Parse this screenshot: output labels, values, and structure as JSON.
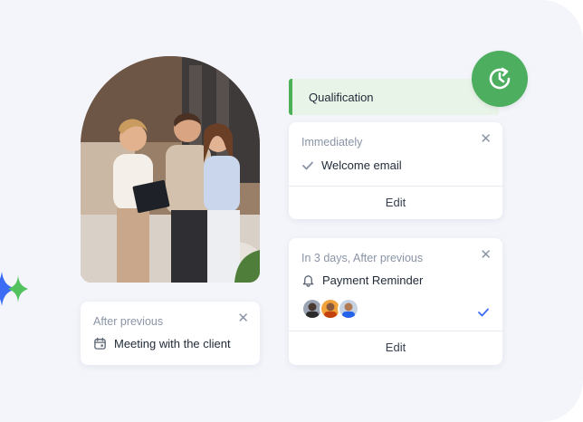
{
  "qualification": {
    "label": "Qualification"
  },
  "card_immediately": {
    "title": "Immediately",
    "item_label": "Welcome email",
    "edit_label": "Edit"
  },
  "card_payment": {
    "title": "In 3 days, After previous",
    "item_label": "Payment Reminder",
    "edit_label": "Edit",
    "assignees_selected": true
  },
  "card_meeting": {
    "title": "After previous",
    "item_label": "Meeting with the client"
  },
  "colors": {
    "accent_green": "#4cae5e",
    "qualification_bg": "#e9f4e8",
    "sparkle_blue": "#3b6cf6",
    "sparkle_green": "#52c25e",
    "check_blue": "#3b6cf6"
  },
  "icons": {
    "badge": "clock-refresh-icon",
    "welcome": "check-icon",
    "payment": "bell-icon",
    "meeting": "calendar-icon",
    "close": "close-icon",
    "selected": "check-icon"
  }
}
